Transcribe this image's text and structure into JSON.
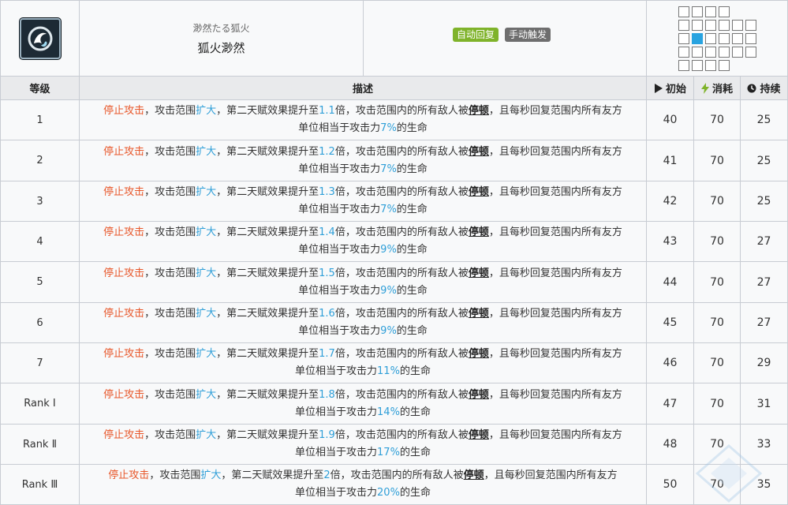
{
  "skill": {
    "name_jp": "渺然たる狐火",
    "name_cn": "狐火渺然",
    "tags": [
      "自动回复",
      "手动触发"
    ]
  },
  "range": {
    "rows": [
      [
        1,
        1,
        1,
        1,
        0,
        0
      ],
      [
        1,
        1,
        1,
        1,
        1,
        1
      ],
      [
        1,
        2,
        1,
        1,
        1,
        1
      ],
      [
        1,
        1,
        1,
        1,
        1,
        1
      ],
      [
        1,
        1,
        1,
        1,
        0,
        0
      ]
    ]
  },
  "header": {
    "level": "等级",
    "desc": "描述",
    "initial": "初始",
    "cost": "消耗",
    "duration": "持续"
  },
  "desc_parts": {
    "stop": "停止攻击",
    "t1": "，攻击范围",
    "expand": "扩大",
    "t2": "，第二天赋效果提升至",
    "t3": "倍，攻击范围内的所有敌人被",
    "stun": "停顿",
    "t4": "，且每秒回复范围内所有友方",
    "t5": "单位相当于攻击力",
    "t6": "的生命"
  },
  "rows": [
    {
      "level": "1",
      "mult": "1.1",
      "pct": "7%",
      "initial": "40",
      "cost": "70",
      "duration": "25"
    },
    {
      "level": "2",
      "mult": "1.2",
      "pct": "7%",
      "initial": "41",
      "cost": "70",
      "duration": "25"
    },
    {
      "level": "3",
      "mult": "1.3",
      "pct": "7%",
      "initial": "42",
      "cost": "70",
      "duration": "25"
    },
    {
      "level": "4",
      "mult": "1.4",
      "pct": "9%",
      "initial": "43",
      "cost": "70",
      "duration": "27"
    },
    {
      "level": "5",
      "mult": "1.5",
      "pct": "9%",
      "initial": "44",
      "cost": "70",
      "duration": "27"
    },
    {
      "level": "6",
      "mult": "1.6",
      "pct": "9%",
      "initial": "45",
      "cost": "70",
      "duration": "27"
    },
    {
      "level": "7",
      "mult": "1.7",
      "pct": "11%",
      "initial": "46",
      "cost": "70",
      "duration": "29"
    },
    {
      "level": "Rank Ⅰ",
      "mult": "1.8",
      "pct": "14%",
      "initial": "47",
      "cost": "70",
      "duration": "31"
    },
    {
      "level": "Rank Ⅱ",
      "mult": "1.9",
      "pct": "17%",
      "initial": "48",
      "cost": "70",
      "duration": "33"
    },
    {
      "level": "Rank Ⅲ",
      "mult": "2",
      "pct": "20%",
      "initial": "50",
      "cost": "70",
      "duration": "35"
    }
  ],
  "colors": {
    "red": "#e8572a",
    "blue": "#2f9fd8",
    "tag_green": "#7fb32a",
    "tag_gray": "#6e6e6e",
    "range_self": "#28a3e0"
  },
  "icons": [
    "skill-fox-fire-icon",
    "play-icon",
    "lightning-icon",
    "clock-icon"
  ]
}
